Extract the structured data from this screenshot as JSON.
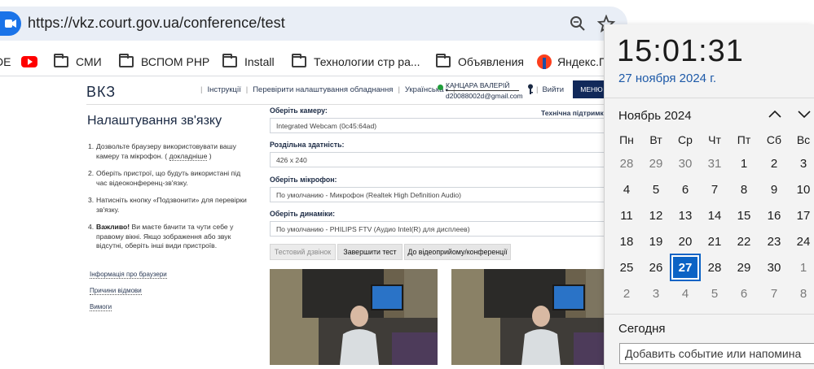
{
  "browser": {
    "url": "https://vkz.court.gov.ua/conference/test",
    "bookmarks": [
      {
        "label": "DE",
        "icon": "bookmark-fav-icon"
      },
      {
        "label": "",
        "icon": "youtube-icon"
      },
      {
        "label": "СМИ",
        "icon": "folder-icon"
      },
      {
        "label": "ВСПОМ PHP",
        "icon": "folder-icon"
      },
      {
        "label": "Install",
        "icon": "folder-icon"
      },
      {
        "label": "Технологии стр ра...",
        "icon": "folder-icon"
      },
      {
        "label": "Объявления",
        "icon": "folder-icon"
      },
      {
        "label": "Яндекс.П",
        "icon": "yandex-icon"
      }
    ]
  },
  "site": {
    "logo": "ВКЗ",
    "nav": {
      "instructions": "Інструкції",
      "check_settings": "Перевірити налаштування обладнання",
      "language": "Українська",
      "user_name": "КАНЦАРА ВАЛЕРІЙ",
      "user_email": "d20088002d@gmail.com",
      "exit": "Вийти",
      "menu": "МЕНЮ"
    },
    "title": "Налаштування зв'язку",
    "steps": {
      "s1_text": "Дозвольте браузеру використовувати вашу камеру та мікрофон. (",
      "s1_link": "докладніше",
      "s1_end": ")",
      "s2": "Оберіть пристрої, що будуть використані під час відеоконференц-зв'язку.",
      "s3": "Натисніть кнопку «Подзвонити» для перевірки зв'язку.",
      "s4_bold": "Важливо!",
      "s4": " Ви маєте бачити та чути себе у правому вікні. Якщо зображення або звук відсутні, оберіть інші види пристроїв."
    },
    "side_links": {
      "browser_info": "Інформація про браузери",
      "decline_reasons": "Причини відмови",
      "requirements": "Вимоги"
    },
    "support": "Технічна підтримка",
    "form": {
      "camera_label": "Оберіть камеру:",
      "camera_value": "Integrated Webcam (0c45:64ad)",
      "resolution_label": "Роздільна здатність:",
      "resolution_value": "426 x 240",
      "mic_label": "Оберіть мікрофон:",
      "mic_value": "По умолчанию - Микрофон (Realtek High Definition Audio)",
      "speakers_label": "Оберіть динаміки:",
      "speakers_value": "По умолчанию - PHILIPS FTV (Аудио Intel(R) для дисплеев)"
    },
    "buttons": {
      "test_call": "Тестовий дзвінок",
      "end_test": "Завершити тест",
      "to_conference": "До відеоприйому/конференції"
    }
  },
  "calendar": {
    "time": "15:01:31",
    "date": "27 ноября 2024 г.",
    "month": "Ноябрь 2024",
    "weekdays": [
      "Пн",
      "Вт",
      "Ср",
      "Чт",
      "Пт",
      "Сб",
      "Вс"
    ],
    "weeks": [
      [
        "28",
        "29",
        "30",
        "31",
        "1",
        "2",
        "3"
      ],
      [
        "4",
        "5",
        "6",
        "7",
        "8",
        "9",
        "10"
      ],
      [
        "11",
        "12",
        "13",
        "14",
        "15",
        "16",
        "17"
      ],
      [
        "18",
        "19",
        "20",
        "21",
        "22",
        "23",
        "24"
      ],
      [
        "25",
        "26",
        "27",
        "28",
        "29",
        "30",
        "1"
      ],
      [
        "2",
        "3",
        "4",
        "5",
        "6",
        "7",
        "8"
      ]
    ],
    "today_label": "Сегодня",
    "event_placeholder": "Добавить событие или напомина",
    "accent_color": "#0b63c5"
  }
}
